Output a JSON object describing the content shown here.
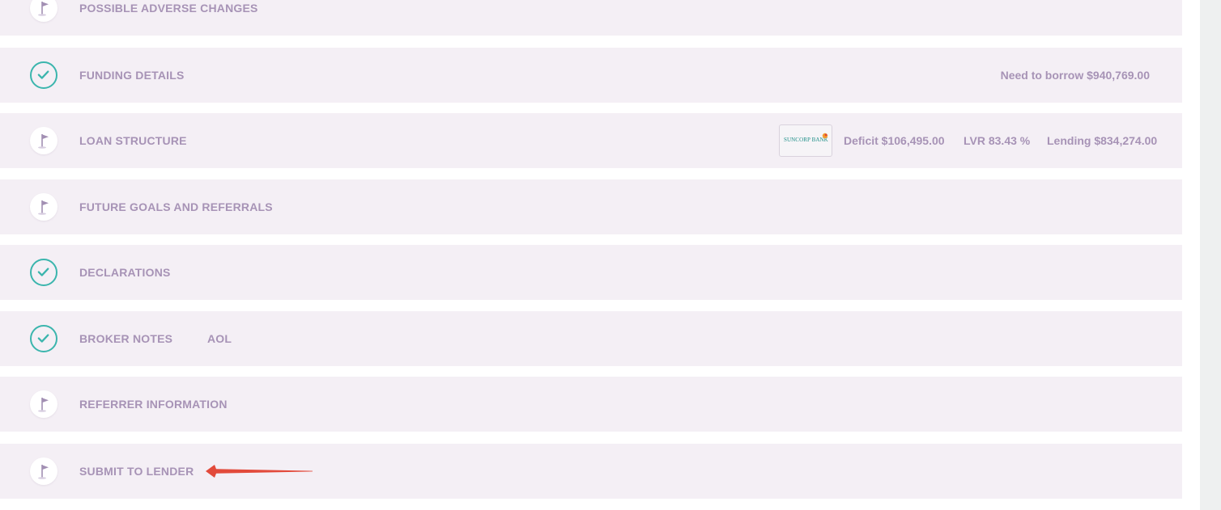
{
  "sections": [
    {
      "label": "POSSIBLE ADVERSE CHANGES",
      "status": "flag",
      "status_icon": "flag-icon"
    },
    {
      "label": "FUNDING DETAILS",
      "status": "complete",
      "status_icon": "check-icon",
      "summary": "Need to borrow $940,769.00"
    },
    {
      "label": "LOAN STRUCTURE",
      "status": "flag",
      "status_icon": "flag-icon",
      "lender_logo_text": "SUNCORP BANK",
      "deficit": "Deficit $106,495.00",
      "lvr": "LVR 83.43 %",
      "lending": "Lending $834,274.00"
    },
    {
      "label": "FUTURE GOALS AND REFERRALS",
      "status": "flag",
      "status_icon": "flag-icon"
    },
    {
      "label": "DECLARATIONS",
      "status": "complete",
      "status_icon": "check-icon"
    },
    {
      "label": "BROKER NOTES",
      "status": "complete",
      "status_icon": "check-icon",
      "sub_label": "AOL"
    },
    {
      "label": "REFERRER INFORMATION",
      "status": "flag",
      "status_icon": "flag-icon"
    },
    {
      "label": "SUBMIT TO LENDER",
      "status": "flag",
      "status_icon": "flag-icon"
    }
  ],
  "colors": {
    "row_background": "#f4eff5",
    "label_text": "#a793b6",
    "check_accent": "#3bb5ad",
    "flag_color": "#a28fb3",
    "annotation_arrow": "#e24a3b",
    "right_rail": "#eef0f0",
    "bank_logo_text": "#1e8f88"
  },
  "annotation": {
    "type": "arrow",
    "points_to": "SUBMIT TO LENDER",
    "icon": "arrow-left-icon"
  }
}
